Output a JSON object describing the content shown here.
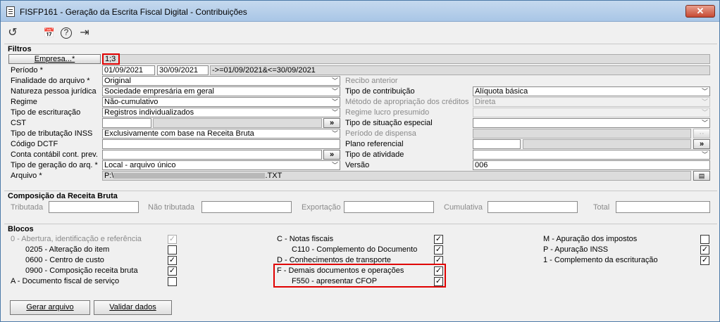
{
  "window": {
    "title": "FISFP161 - Geração da Escrita Fiscal Digital - Contribuições",
    "close": "✕"
  },
  "toolbar": {
    "undo": "↺",
    "calendar": "📅",
    "help": "?",
    "exit": "⇥"
  },
  "filtros": {
    "title": "Filtros",
    "empresa_button": "Empresa...*",
    "empresa_value": "1;3",
    "periodo_label": "Período *",
    "periodo_from": "01/09/2021",
    "periodo_to": "30/09/2021",
    "periodo_expr": "->=01/09/2021&<=30/09/2021",
    "finalidade_label": "Finalidade do arquivo *",
    "finalidade_value": "Original",
    "natureza_label": "Natureza pessoa jurídica",
    "natureza_value": "Sociedade empresária em geral",
    "regime_label": "Regime",
    "regime_value": "Não-cumulativo",
    "tipo_escrit_label": "Tipo de escrituração",
    "tipo_escrit_value": "Registros individualizados",
    "cst_label": "CST",
    "cst_button": "»",
    "tipo_trib_label": "Tipo de tributação INSS",
    "tipo_trib_value": "Exclusivamente com base na Receita Bruta",
    "codigo_dctf_label": "Código DCTF",
    "conta_label": "Conta contábil cont. prev.",
    "conta_button": "»",
    "tipo_geracao_label": "Tipo de geração do arq. *",
    "tipo_geracao_value": "Local - arquivo único",
    "arquivo_label": "Arquivo *",
    "arquivo_prefix": "P:\\",
    "arquivo_suffix": ".TXT",
    "recibo_label": "Recibo anterior",
    "tipo_contrib_label": "Tipo de contribuição",
    "tipo_contrib_value": "Alíquota básica",
    "metodo_label": "Método de apropriação dos créditos",
    "metodo_value": "Direta",
    "regime_lucro_label": "Regime lucro presumido",
    "tipo_situacao_label": "Tipo de situação especial",
    "periodo_dispensa_label": "Período de dispensa",
    "plano_label": "Plano referencial",
    "plano_button": "»",
    "tipo_atividade_label": "Tipo de atividade",
    "versao_label": "Versão",
    "versao_value": "006"
  },
  "composicao": {
    "title": "Composição da Receita Bruta",
    "tributada": "Tributada",
    "nao_tributada": "Não tributada",
    "exportacao": "Exportação",
    "cumulativa": "Cumulativa",
    "total": "Total"
  },
  "blocos": {
    "title": "Blocos",
    "col1": [
      {
        "label": "0 - Abertura, identificação e referência",
        "checked": true
      },
      {
        "label": "0205 - Alteração do item",
        "checked": false
      },
      {
        "label": "0600 - Centro de custo",
        "checked": true
      },
      {
        "label": "0900 - Composição receita bruta",
        "checked": true
      },
      {
        "label": "A - Documento fiscal de serviço",
        "checked": false
      }
    ],
    "col2": [
      {
        "label": "C - Notas fiscais",
        "checked": true
      },
      {
        "label": "C110 - Complemento do Documento",
        "checked": true
      },
      {
        "label": "D - Conhecimentos de transporte",
        "checked": true
      },
      {
        "label": "F - Demais documentos e operações",
        "checked": true
      },
      {
        "label": "F550 - apresentar CFOP",
        "checked": true
      }
    ],
    "col3": [
      {
        "label": "M - Apuração dos impostos",
        "checked": false
      },
      {
        "label": "P - Apuração INSS",
        "checked": true
      },
      {
        "label": "1 - Complemento da escrituração",
        "checked": true
      }
    ],
    "check_glyph": "✓"
  },
  "actions": {
    "gerar": "Gerar arquivo",
    "validar": "Validar dados"
  },
  "colors": {
    "highlight": "#e00000",
    "titlebar": "#b6cfea"
  }
}
